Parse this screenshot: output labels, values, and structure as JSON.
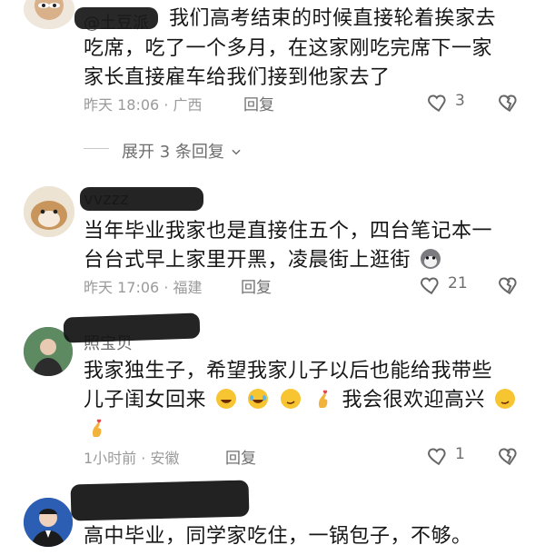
{
  "comments": [
    {
      "username": "@土豆派",
      "text_lines": [
        "我们高考结束的时候直接轮着挨家去",
        "吃席，吃了一个多月，在这家刚吃完席下一家",
        "家长直接雇车给我们接到他家去了"
      ],
      "meta": "昨天 18:06 · 广西",
      "reply_label": "回复",
      "likes": "3",
      "expand_label": "展开 3 条回复"
    },
    {
      "username": "vvzzz",
      "text_lines": [
        "当年毕业我家也是直接住五个，四台笔记本一",
        "台台式早上家里开黑，凌晨街上逛街"
      ],
      "meta": "昨天 17:06 · 福建",
      "reply_label": "回复",
      "likes": "21"
    },
    {
      "username": "照宝贝",
      "text_lines": [
        "我家独生子，希望我家儿子以后也能给我带些",
        "儿子闺女回来",
        "我会很欢迎高兴"
      ],
      "meta": "1小时前 · 安徽",
      "reply_label": "回复",
      "likes": "1"
    },
    {
      "text_lines": [
        "高中毕业，同学家吃住，一锅包子，不够。"
      ]
    }
  ]
}
